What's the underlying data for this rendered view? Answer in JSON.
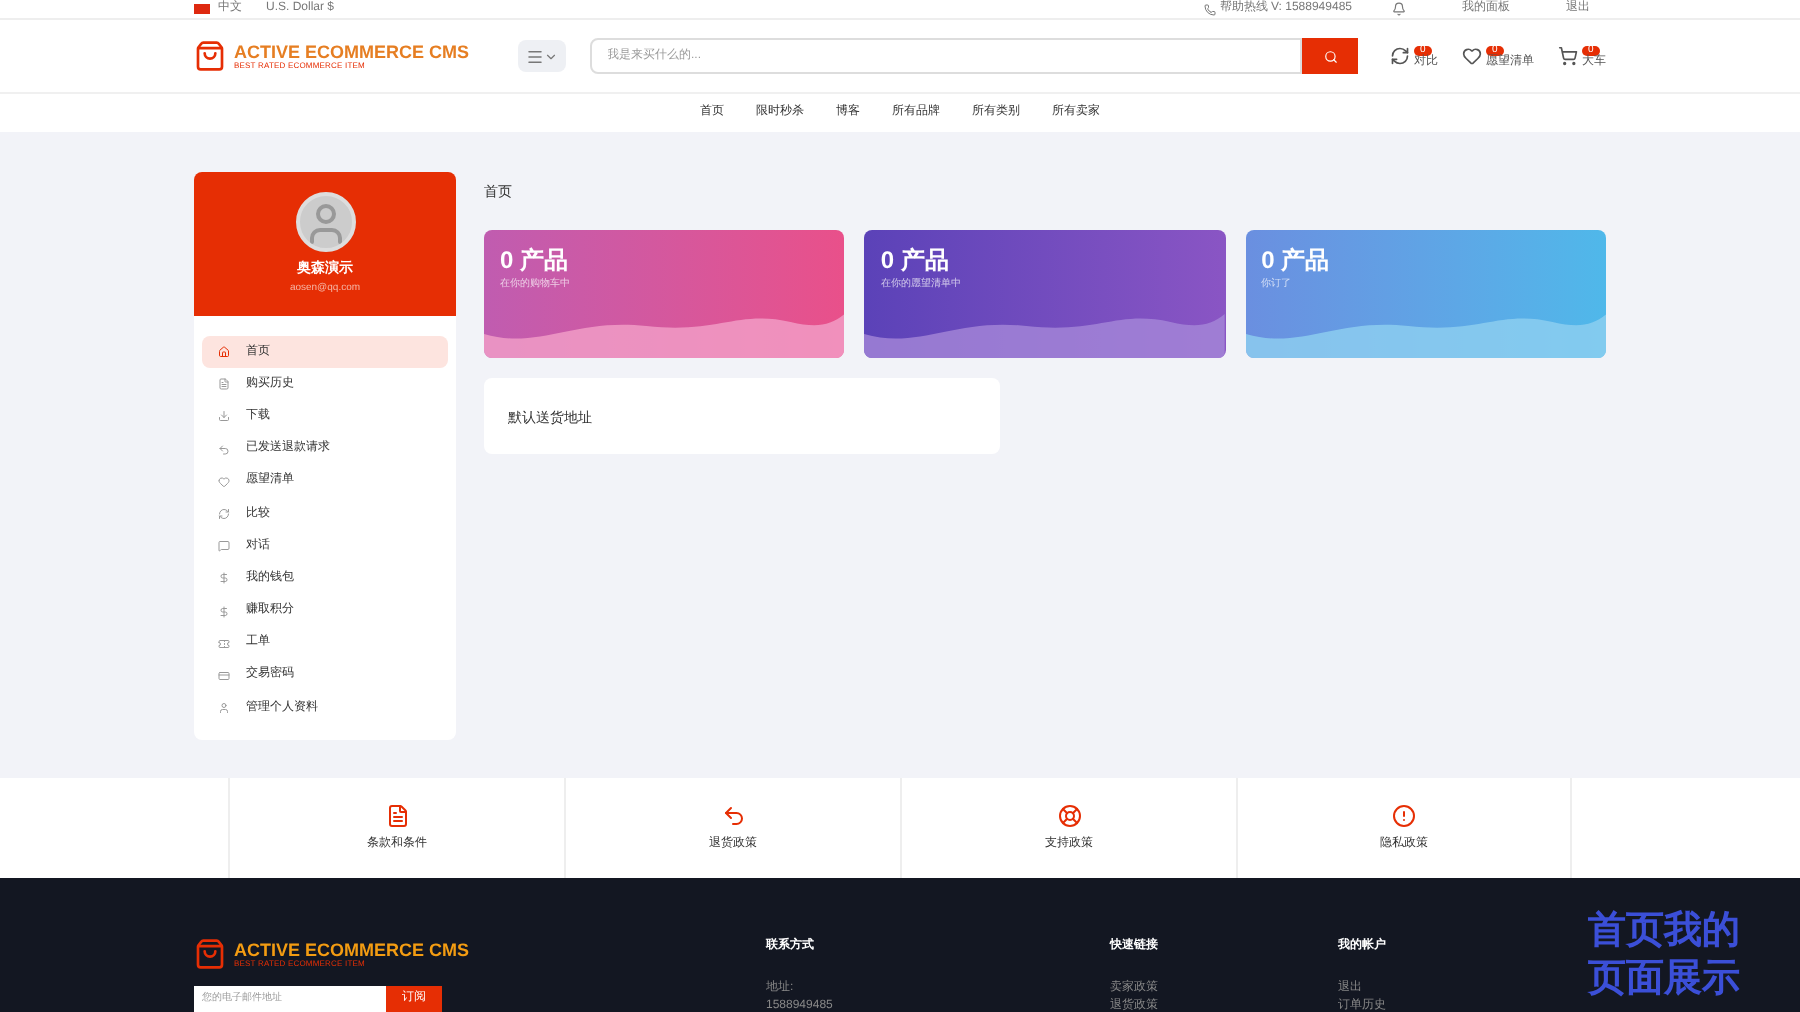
{
  "top_bar": {
    "language": "中文",
    "currency": "U.S. Dollar $",
    "hotline": "帮助热线 V: 1588949485",
    "links": [
      "我的面板",
      "退出"
    ]
  },
  "header": {
    "logo": {
      "title": "ACTIVE ECOMMERCE CMS",
      "tagline": "BEST RATED ECOMMERCE ITEM"
    },
    "search": {
      "placeholder": "我是来买什么的..."
    },
    "actions": [
      {
        "kind": "compare",
        "label": "对比",
        "count": "0"
      },
      {
        "kind": "wishlist",
        "label": "愿望清单",
        "count": "0"
      },
      {
        "kind": "cart",
        "label": "大车",
        "count": "0"
      }
    ]
  },
  "nav": [
    "首页",
    "限时秒杀",
    "博客",
    "所有品牌",
    "所有类别",
    "所有卖家"
  ],
  "profile": {
    "name": "奥森演示",
    "email": "aosen@qq.com"
  },
  "sidebar": {
    "items": [
      {
        "kind": "home",
        "label": "首页",
        "selected": true
      },
      {
        "kind": "history",
        "label": "购买历史",
        "selected": false
      },
      {
        "kind": "download",
        "label": "下载",
        "selected": false
      },
      {
        "kind": "refund",
        "label": "已发送退款请求",
        "selected": false
      },
      {
        "kind": "wishlist",
        "label": "愿望清单",
        "selected": false
      },
      {
        "kind": "compare",
        "label": "比较",
        "selected": false
      },
      {
        "kind": "chat",
        "label": "对话",
        "selected": false
      },
      {
        "kind": "wallet",
        "label": "我的钱包",
        "selected": false
      },
      {
        "kind": "points",
        "label": "赚取积分",
        "selected": false
      },
      {
        "kind": "ticket",
        "label": "工单",
        "selected": false
      },
      {
        "kind": "password",
        "label": "交易密码",
        "selected": false
      },
      {
        "kind": "profile",
        "label": "管理个人资料",
        "selected": false
      }
    ]
  },
  "breadcrumb": "首页",
  "stats": [
    {
      "kind": "pink",
      "value": "0 产品",
      "caption": "在你的购物车中"
    },
    {
      "kind": "purple",
      "value": "0 产品",
      "caption": "在你的愿望清单中"
    },
    {
      "kind": "blue",
      "value": "0 产品",
      "caption": "你订了"
    }
  ],
  "address_card": {
    "title": "默认送货地址"
  },
  "policies": [
    {
      "kind": "terms",
      "label": "条款和条件"
    },
    {
      "kind": "return",
      "label": "退货政策"
    },
    {
      "kind": "support",
      "label": "支持政策"
    },
    {
      "kind": "privacy",
      "label": "隐私政策"
    }
  ],
  "footer": {
    "logo": {
      "title": "ACTIVE ECOMMERCE CMS",
      "tagline": "BEST RATED ECOMMERCE ITEM"
    },
    "email_placeholder": "您的电子邮件地址",
    "subscribe": "订阅",
    "columns": [
      {
        "title": "联系方式",
        "items": [
          "地址:",
          "1588949485"
        ]
      },
      {
        "title": "快速链接",
        "items": [
          "卖家政策",
          "退货政策"
        ]
      },
      {
        "title": "我的帐户",
        "items": [
          "退出",
          "订单历史"
        ]
      }
    ]
  },
  "caption": "首页我的页面展示"
}
